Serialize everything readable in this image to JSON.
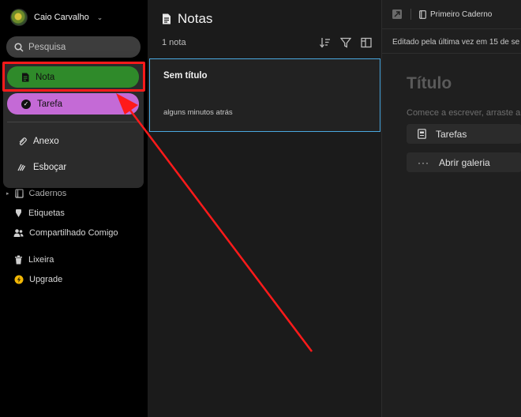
{
  "sidebar": {
    "user_name": "Caio Carvalho",
    "search_placeholder": "Pesquisa",
    "nav": [
      {
        "label": "Cadernos",
        "icon": "notebook-icon"
      },
      {
        "label": "Etiquetas",
        "icon": "tag-icon"
      },
      {
        "label": "Compartilhado Comigo",
        "icon": "people-icon"
      },
      {
        "label": "Lixeira",
        "icon": "trash-icon"
      },
      {
        "label": "Upgrade",
        "icon": "lightning-icon"
      }
    ]
  },
  "dropdown": {
    "nota": "Nota",
    "tarefa": "Tarefa",
    "anexo": "Anexo",
    "esbocar": "Esboçar"
  },
  "note_list": {
    "title": "Notas",
    "count": "1 nota",
    "notes": [
      {
        "title": "Sem título",
        "time": "alguns minutos atrás"
      }
    ]
  },
  "editor": {
    "notebook": "Primeiro Caderno",
    "edited": "Editado pela última vez em 15 de se",
    "title_placeholder": "Título",
    "hint": "Comece a escrever, arraste a",
    "buttons": [
      {
        "label": "Tarefas",
        "icon": "task-icon"
      },
      {
        "label": "Abrir galeria",
        "icon": "ellipsis-icon"
      }
    ]
  },
  "colors": {
    "nota_green": "#2f8a2a",
    "tarefa_purple": "#c46ad6",
    "highlight_red": "#ff1a1a",
    "selection_blue": "#4aa8e0"
  }
}
